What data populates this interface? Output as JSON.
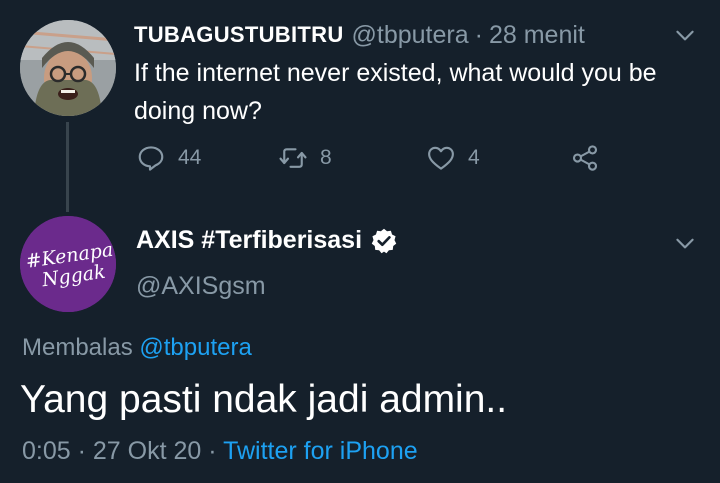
{
  "parent_tweet": {
    "display_name": "TUBAGUSTUBITRU",
    "handle": "@tbputera",
    "separator": "·",
    "time": "28 menit",
    "text": "If the internet never existed, what would you be doing now?",
    "actions": {
      "reply_count": "44",
      "retweet_count": "8",
      "like_count": "4"
    },
    "avatar_icon": "profile-photo"
  },
  "main_tweet": {
    "display_name": "AXIS #Terfiberisasi",
    "verified": true,
    "handle": "@AXISgsm",
    "avatar_text": "#Kenapa Nggak",
    "avatar_color": "#6b2a8c",
    "reply_prefix": "Membalas",
    "reply_mention": "@tbputera",
    "text": "Yang pasti ndak jadi admin..",
    "time": "0:05",
    "separator": "·",
    "date": "27 Okt 20",
    "separator2": "·",
    "client": "Twitter for iPhone"
  },
  "colors": {
    "background": "#15202b",
    "secondary_text": "#8899a6",
    "accent": "#1da1f2",
    "thread_line": "#38444d"
  },
  "icons": [
    "chevron-down-icon",
    "reply-icon",
    "retweet-icon",
    "like-icon",
    "share-icon",
    "verified-badge-icon"
  ]
}
